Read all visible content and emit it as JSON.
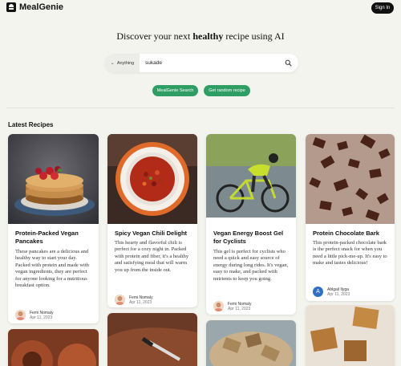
{
  "nav": {
    "brand": "MealGenie",
    "signin": "Sign In"
  },
  "hero": {
    "prefix": "Discover your next ",
    "highlight": "healthy",
    "suffix": " recipe using AI"
  },
  "search": {
    "scope": "Anything",
    "value": "sukade",
    "placeholder": ""
  },
  "buttons": {
    "search": "MealGenie Search",
    "random": "Get random recipe"
  },
  "latest": {
    "title": "Latest Recipes",
    "cards": [
      {
        "title": "Protein-Packed Vegan Pancakes",
        "description": "These pancakes are a delicious and healthy way to start your day. Packed with protein and made with vegan ingredients, they are perfect for anyone looking for a nutritious breakfast option.",
        "author": "Femi Nomaly",
        "date": "Apr 11, 2023"
      },
      {
        "title": "Spicy Vegan Chili Delight",
        "description": "This hearty and flavorful chili is perfect for a cozy night in. Packed with protein and fiber, it's a healthy and satisfying meal that will warm you up from the inside out.",
        "author": "Femi Nomaly",
        "date": "Apr 11, 2023"
      },
      {
        "title": "Vegan Energy Boost Gel for Cyclists",
        "description": "This gel is perfect for cyclists who need a quick and easy source of energy during long rides. It's vegan, easy to make, and packed with nutrients to keep you going.",
        "author": "Femi Nomaly",
        "date": "Apr 11, 2023"
      },
      {
        "title": "Protein Chocolate Bark",
        "description": "This protein-packed chocolate bark is the perfect snack for when you need a little pick-me-up. It's easy to make and tastes delicious!",
        "author": "Abigail Ilyga",
        "avatar_letter": "A",
        "date": "Apr 11, 2023"
      }
    ]
  },
  "colors": {
    "accent": "#2e9e65",
    "background": "#f4f4ee",
    "avatar_blue": "#2f6fc7"
  }
}
